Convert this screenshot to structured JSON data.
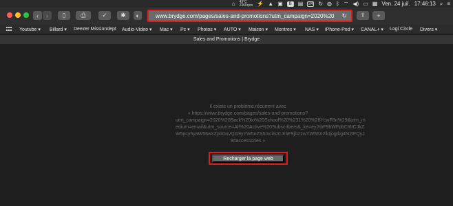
{
  "menubar": {
    "temperature": "43°C",
    "rpm": "2360rpm",
    "badge_b": "B",
    "badge_24": "24",
    "date": "Ven. 24 juil.",
    "time": "17:46:13"
  },
  "browser": {
    "url": "www.brydge.com/pages/sales-and-promotions?utm_campaign=2020%20"
  },
  "bookmarks": [
    {
      "label": "Youtube ▾"
    },
    {
      "label": "Billard ▾"
    },
    {
      "label": "Deezer Missiondept"
    },
    {
      "label": "Audio-Video ▾"
    },
    {
      "label": "Mac ▾"
    },
    {
      "label": "Pc ▾"
    },
    {
      "label": "Photos ▾"
    },
    {
      "label": "AUTO ▾"
    },
    {
      "label": "Maison ▾"
    },
    {
      "label": "Montres ▾"
    },
    {
      "label": "NAS ▾"
    },
    {
      "label": "iPhone-Pod ▾"
    },
    {
      "label": "CANAL+ ▾"
    },
    {
      "label": "Logi Circle"
    },
    {
      "label": "Divers ▾"
    }
  ],
  "tab": {
    "title": "Sales and Promotions | Brydge"
  },
  "error": {
    "lines": [
      "Il existe un problème récurrent avec",
      "« https://www.brydge.com/pages/sales-and-promotions?",
      "utm_campaign=2020%20Back%20to%20School%20%231%20%28YcwF8n%29&utm_m",
      "edium=email&utm_source=All%20Active%20Subscribers&_ke=eyJrbF9bWFpbCI6ICJkZ",
      "W5pcy5yaW56aXZpbGxvQG9yYW5nZS5mciIsICJrbF9jb21wYW55X2lkIjogIkg4N2tFQyJ",
      "9#accessories »"
    ],
    "reload_label": "Recharger la page web"
  }
}
